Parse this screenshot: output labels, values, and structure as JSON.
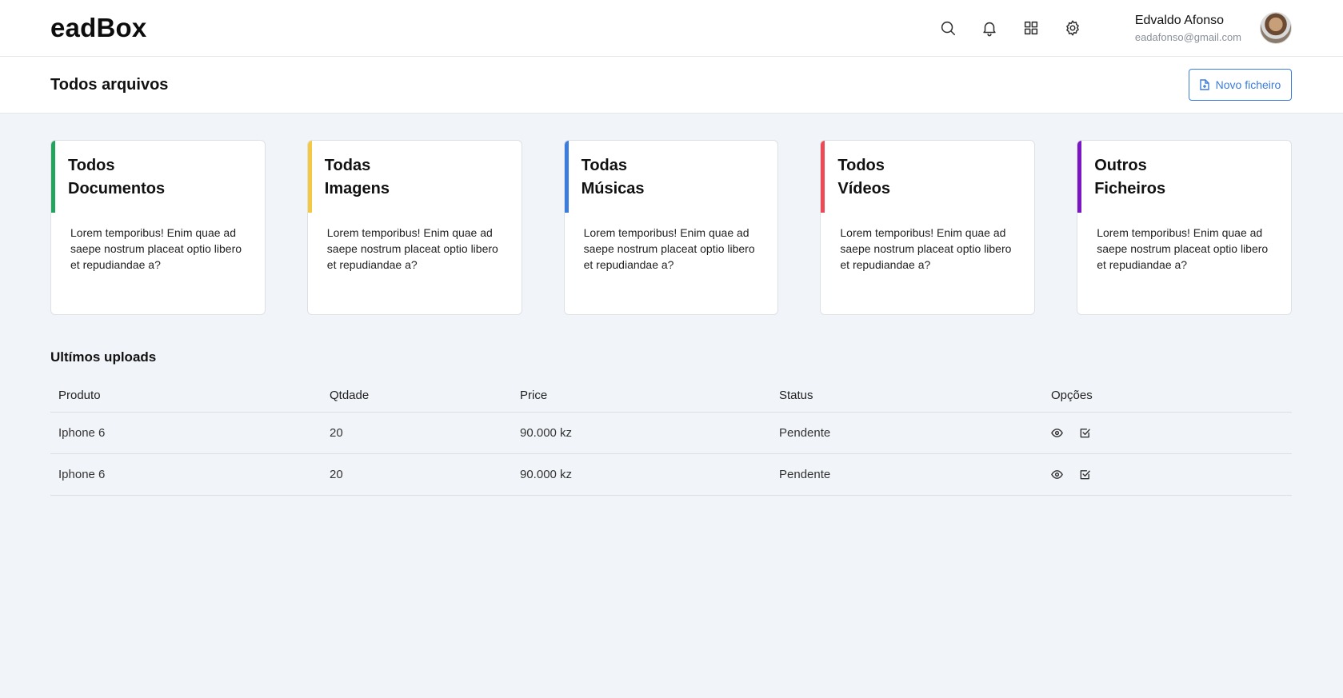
{
  "app": {
    "logo": "eadBox"
  },
  "header": {
    "icons": [
      "search-icon",
      "bell-icon",
      "grid-icon",
      "gear-icon"
    ],
    "user": {
      "name": "Edvaldo Afonso",
      "email": "eadafonso@gmail.com"
    }
  },
  "subheader": {
    "title": "Todos arquivos",
    "new_file_label": "Novo ficheiro"
  },
  "cards": [
    {
      "line1": "Todos",
      "line2": "Documentos",
      "text": "Lorem temporibus! Enim quae ad saepe nostrum placeat optio libero et repudiandae a?",
      "color": "#22a45d"
    },
    {
      "line1": "Todas",
      "line2": "Imagens",
      "text": "Lorem temporibus! Enim quae ad saepe nostrum placeat optio libero et repudiandae a?",
      "color": "#f5c842"
    },
    {
      "line1": "Todas",
      "line2": "Músicas",
      "text": "Lorem temporibus! Enim quae ad saepe nostrum placeat optio libero et repudiandae a?",
      "color": "#3b7ddd"
    },
    {
      "line1": "Todos",
      "line2": "Vídeos",
      "text": "Lorem temporibus! Enim quae ad saepe nostrum placeat optio libero et repudiandae a?",
      "color": "#ec4a55"
    },
    {
      "line1": "Outros",
      "line2": "Ficheiros",
      "text": "Lorem temporibus! Enim quae ad saepe nostrum placeat optio libero et repudiandae a?",
      "color": "#7a16c4"
    }
  ],
  "uploads": {
    "title": "Ultímos uploads",
    "columns": [
      "Produto",
      "Qtdade",
      "Price",
      "Status",
      "Opções"
    ],
    "rows": [
      {
        "produto": "Iphone 6",
        "qtdade": "20",
        "price": "90.000 kz",
        "status": "Pendente"
      },
      {
        "produto": "Iphone 6",
        "qtdade": "20",
        "price": "90.000 kz",
        "status": "Pendente"
      }
    ],
    "row_icons": [
      "eye-icon",
      "check-square-icon"
    ]
  }
}
